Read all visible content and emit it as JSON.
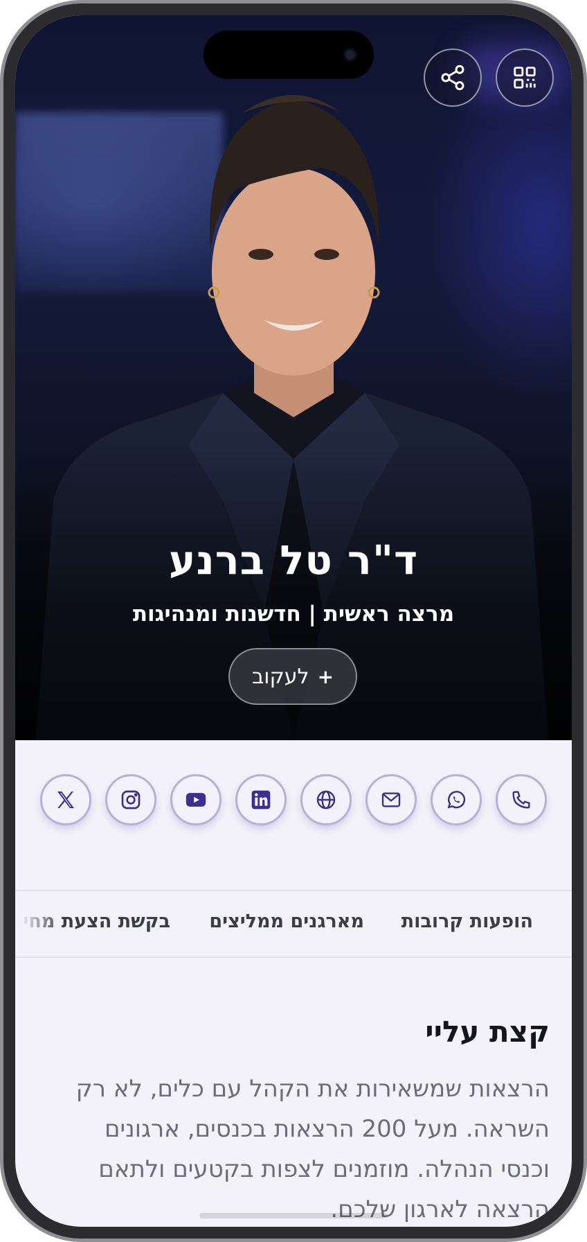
{
  "profile": {
    "name": "ד\"ר טל ברנע",
    "title": "מרצה ראשית | חדשנות ומנהיגות",
    "follow_plus": "+",
    "follow_label": "לעקוב"
  },
  "header_actions": {
    "share_icon": "share-icon",
    "qr_icon": "qr-code-icon"
  },
  "social": [
    {
      "name": "phone-icon"
    },
    {
      "name": "whatsapp-icon"
    },
    {
      "name": "email-icon"
    },
    {
      "name": "globe-icon"
    },
    {
      "name": "linkedin-icon"
    },
    {
      "name": "youtube-icon"
    },
    {
      "name": "instagram-icon"
    },
    {
      "name": "x-icon"
    }
  ],
  "tabs": [
    "הופעות קרובות",
    "מארגנים ממליצים",
    "בקשת הצעת מחיר"
  ],
  "about": {
    "title": "קצת עליי",
    "text": "הרצאות שמשאירות את הקהל עם כלים, לא רק השראה. מעל 200 הרצאות בכנסים, ארגונים וכנסי הנהלה. מוזמנים לצפות בקטעים ולתאם הרצאה לארגון שלכם."
  },
  "colors": {
    "accent": "#3b2f8f",
    "social_border": "#b7b0da",
    "background": "#f3f2fa"
  }
}
